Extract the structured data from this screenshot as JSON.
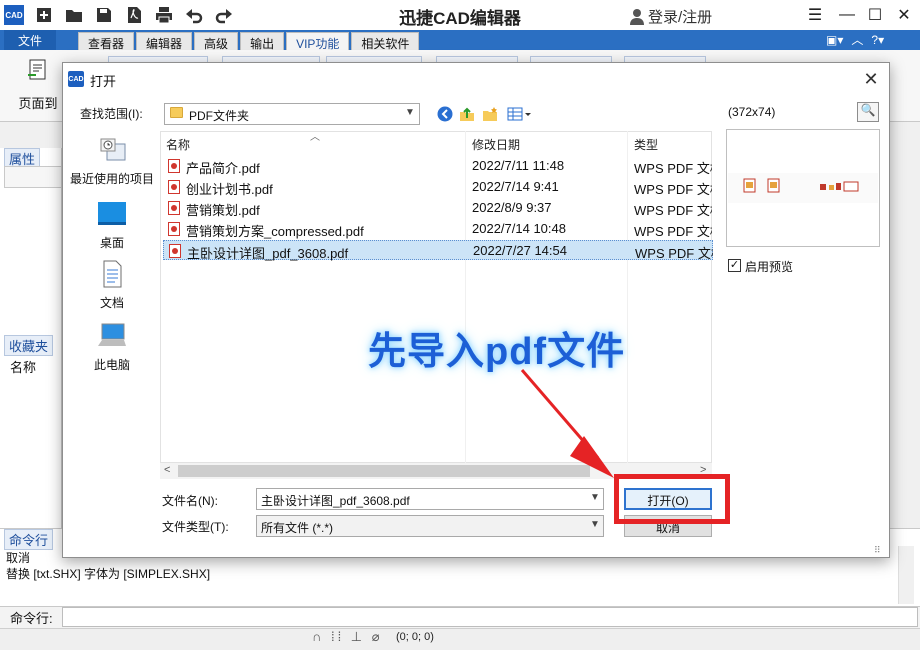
{
  "app": {
    "title": "迅捷CAD编辑器",
    "login": "登录/注册",
    "logo_text": "CAD"
  },
  "menubar": {
    "items": [
      "文件",
      "查看器",
      "编辑器",
      "高级",
      "输出",
      "VIP功能",
      "相关软件"
    ]
  },
  "ribbon": {
    "page_label": "页面到"
  },
  "left_panel": {
    "properties_tab": "属性",
    "favorites_tab": "收藏夹",
    "name_label": "名称"
  },
  "command": {
    "tab": "命令行",
    "lines": [
      "取消",
      "替换 [txt.SHX] 字体为 [SIMPLEX.SHX]"
    ],
    "input_label": "命令行:"
  },
  "statusbar": {
    "coords": "(0; 0; 0)"
  },
  "dialog": {
    "title": "打开",
    "icon_text": "CAD",
    "look_in_label": "查找范围(I):",
    "look_in_value": "PDF文件夹",
    "preview_size": "(372x74)",
    "places": [
      "最近使用的项目",
      "桌面",
      "文档",
      "此电脑"
    ],
    "columns": [
      "名称",
      "修改日期",
      "类型"
    ],
    "files": [
      {
        "name": "产品简介.pdf",
        "date": "2022/7/11 11:48",
        "type": "WPS PDF 文档"
      },
      {
        "name": "创业计划书.pdf",
        "date": "2022/7/14 9:41",
        "type": "WPS PDF 文档"
      },
      {
        "name": "营销策划.pdf",
        "date": "2022/8/9 9:37",
        "type": "WPS PDF 文档"
      },
      {
        "name": "营销策划方案_compressed.pdf",
        "date": "2022/7/14 10:48",
        "type": "WPS PDF 文档"
      },
      {
        "name": "主卧设计详图_pdf_3608.pdf",
        "date": "2022/7/27 14:54",
        "type": "WPS PDF 文档"
      }
    ],
    "selected_index": 4,
    "preview_checkbox_label": "启用预览",
    "preview_checked": true,
    "filename_label": "文件名(N):",
    "filename_value": "主卧设计详图_pdf_3608.pdf",
    "filetype_label": "文件类型(T):",
    "filetype_value": "所有文件 (*.*)",
    "open_button": "打开(O)",
    "cancel_button": "取消"
  },
  "annotation": {
    "text": "先导入pdf文件",
    "color": "#1c5fd6",
    "highlight_color": "#e52325"
  }
}
